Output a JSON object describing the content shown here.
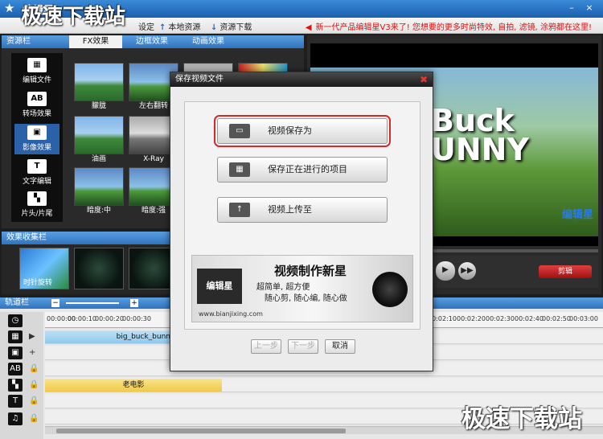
{
  "app": {
    "title": "编辑星",
    "minimize": "–",
    "close": "×"
  },
  "toolbar": {
    "items": [
      "设定",
      "本地资源",
      "资源下载"
    ],
    "promo": "新一代产品编辑星V3来了! 您想要的更多时尚特效, 自拍, 滤镜, 涂鸦都在这里!"
  },
  "resource_panel": {
    "header": "资源栏",
    "tabs": [
      "FX效果",
      "边框效果",
      "动画效果"
    ],
    "active_tab": "FX效果",
    "categories": [
      "编辑文件",
      "转场效果",
      "影像效果",
      "文字编辑",
      "片头/片尾"
    ],
    "active_category": "影像效果",
    "thumbnails": [
      "朦胧",
      "左右翻转",
      "油画",
      "X-Ray",
      "暗度:中",
      "暗度:强"
    ]
  },
  "effects_bar": {
    "header": "效果收集栏",
    "items": [
      "时针旋转"
    ]
  },
  "preview": {
    "title_text": [
      "Buck",
      "UNNY"
    ],
    "watermark": "编辑星",
    "cut_button": "剪辑",
    "controls": [
      "◀◀",
      "▶",
      "▶▶"
    ]
  },
  "timeline": {
    "header": "轨道栏",
    "ticks": [
      "00:00:00",
      "00:00:10",
      "00:00:20",
      "00:00:30",
      "00:02:10",
      "00:02:20",
      "00:02:30",
      "00:02:40",
      "00:02:50",
      "00:03:00"
    ],
    "video_clip": "big_buck_bunny",
    "music_clip": "老电影"
  },
  "dialog": {
    "title": "保存视频文件",
    "buttons": [
      "视频保存为",
      "保存正在进行的项目",
      "视频上传至"
    ],
    "banner_heading": "视频制作新星",
    "banner_line1": "超简单, 超方便",
    "banner_line2": "随心剪, 随心编, 随心做",
    "banner_logo": "编辑星",
    "banner_url": "www.bianjixing.com",
    "prev": "上一步",
    "next": "下一步",
    "cancel": "取消"
  },
  "overlay": {
    "watermark": "极速下载站"
  },
  "colors": {
    "accent": "#2f73bf",
    "highlight": "#d32a2a"
  }
}
